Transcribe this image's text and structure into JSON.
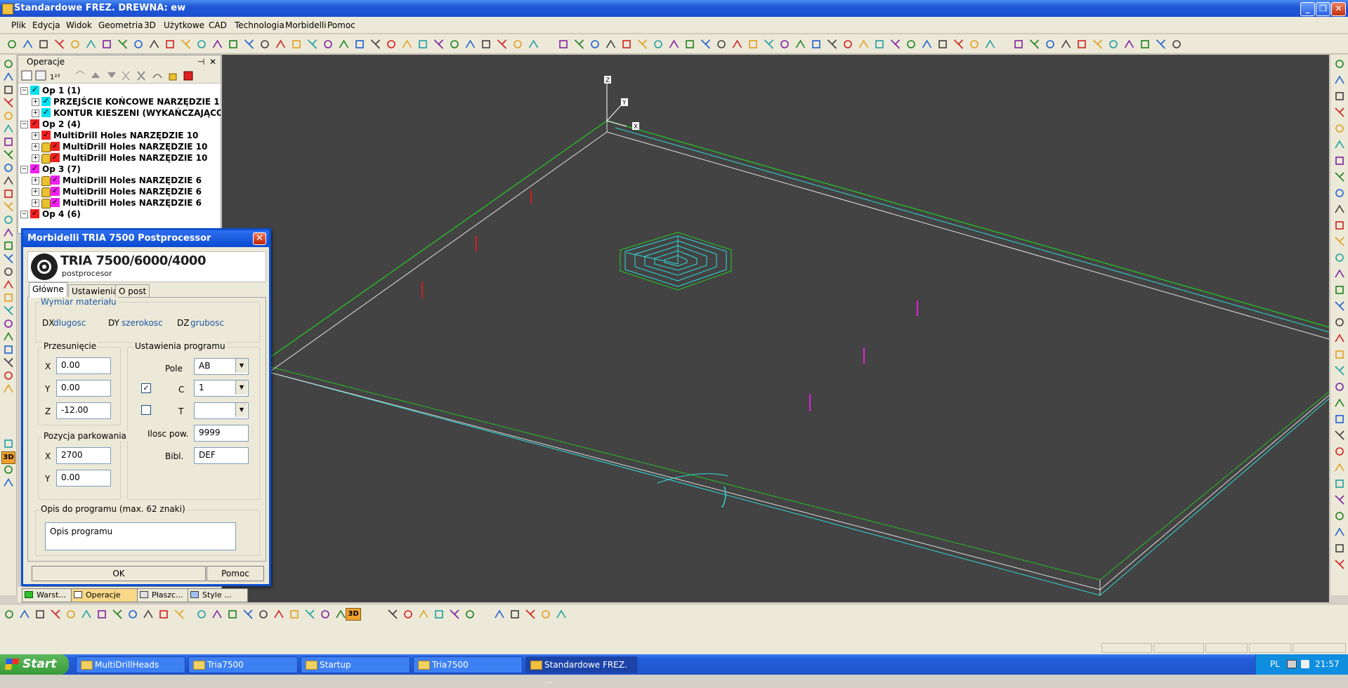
{
  "window": {
    "title": "Standardowe FREZ. DREWNA: ew",
    "minimize": "_",
    "restore": "❐",
    "close": "✕"
  },
  "menu": [
    "Plik",
    "Edycja",
    "Widok",
    "Geometria",
    "3D",
    "Użytkowe",
    "CAD",
    "Technologia",
    "Morbidelli",
    "Pomoc"
  ],
  "operations_panel": {
    "title": "Operacje",
    "pin": "⊣",
    "close": "✕",
    "tree": [
      {
        "label": "Op 1   (1)",
        "level": 0,
        "color": "#00e0f0",
        "lock": false
      },
      {
        "label": "PRZEJŚCIE KOŃCOWE   NARZĘDZIE 1",
        "level": 1,
        "color": "#00e0f0",
        "lock": false
      },
      {
        "label": "KONTUR KIESZENI (WYKAŃCZAJĄCO)",
        "level": 1,
        "color": "#00e0f0",
        "lock": false
      },
      {
        "label": "Op 2   (4)",
        "level": 0,
        "color": "#f02020",
        "lock": false
      },
      {
        "label": "MultiDrill Holes   NARZĘDZIE 10",
        "level": 1,
        "color": "#f02020",
        "lock": false
      },
      {
        "label": "MultiDrill Holes   NARZĘDZIE 10",
        "level": 1,
        "color": "#f02020",
        "lock": true
      },
      {
        "label": "MultiDrill Holes   NARZĘDZIE 10",
        "level": 1,
        "color": "#f02020",
        "lock": true
      },
      {
        "label": "Op 3   (7)",
        "level": 0,
        "color": "#f020f0",
        "lock": false
      },
      {
        "label": "MultiDrill Holes   NARZĘDZIE 6",
        "level": 1,
        "color": "#f020f0",
        "lock": true
      },
      {
        "label": "MultiDrill Holes   NARZĘDZIE 6",
        "level": 1,
        "color": "#f020f0",
        "lock": true
      },
      {
        "label": "MultiDrill Holes   NARZĘDZIE 6",
        "level": 1,
        "color": "#f020f0",
        "lock": true
      },
      {
        "label": "Op 4   (6)",
        "level": 0,
        "color": "#f02020",
        "lock": false
      }
    ]
  },
  "dialog": {
    "title": "Morbidelli TRIA 7500 Postprocessor",
    "close": "✕",
    "header_title": "TRIA 7500/6000/4000",
    "header_sub": "postprocesor",
    "tabs": [
      "Główne",
      "Ustawienia",
      "O post"
    ],
    "material": {
      "group": "Wymiar materiału",
      "dx_label": "DX",
      "dx_value": "dlugosc",
      "dy_label": "DY",
      "dy_value": "szerokosc",
      "dz_label": "DZ",
      "dz_value": "grubosc"
    },
    "offset": {
      "group": "Przesunięcie",
      "x_label": "X",
      "x": "0.00",
      "y_label": "Y",
      "y": "0.00",
      "z_label": "Z",
      "z": "-12.00"
    },
    "program": {
      "group": "Ustawienia programu",
      "pole_label": "Pole",
      "pole": "AB",
      "c_label": "C",
      "c": "1",
      "c_checked": true,
      "t_label": "T",
      "t": "",
      "t_checked": false,
      "count_label": "Ilosc pow.",
      "count": "9999",
      "lib_label": "Bibl.",
      "lib": "DEF"
    },
    "parking": {
      "group": "Pozycja parkowania",
      "x_label": "X",
      "x": "2700",
      "y_label": "Y",
      "y": "0.00"
    },
    "description": {
      "group": "Opis do programu (max. 62 znaki)",
      "value": "Opis programu"
    },
    "ok": "OK",
    "help": "Pomoc"
  },
  "panel_tabs": [
    "Warst...",
    "Operacje",
    "Płaszc...",
    "Style ..."
  ],
  "viewport": {
    "axis_z": "Z",
    "axis_y": "Y",
    "axis_x": "X",
    "colors": {
      "background": "#434343",
      "green": "#22cc22",
      "cyan": "#30d8d8",
      "white": "#e0e0e0",
      "magenta": "#e020e0",
      "red": "#d02020"
    }
  },
  "toolbar_button_3d": "3D",
  "taskbar": {
    "start": "Start",
    "tasks": [
      "MultiDrillHeads",
      "Tria7500",
      "Startup",
      "Tria7500",
      "Standardowe FREZ. ..."
    ],
    "lang": "PL",
    "time": "21:57"
  }
}
